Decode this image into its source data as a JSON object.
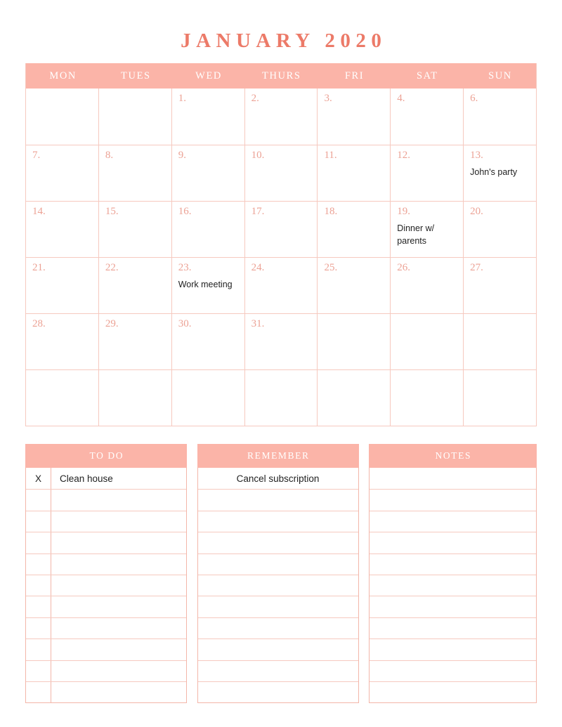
{
  "title": "JANUARY 2020",
  "calendar": {
    "weekdays": [
      "MON",
      "TUES",
      "WED",
      "THURS",
      "FRI",
      "SAT",
      "SUN"
    ],
    "weeks": [
      [
        {
          "day": "",
          "event": ""
        },
        {
          "day": "",
          "event": ""
        },
        {
          "day": "1.",
          "event": ""
        },
        {
          "day": "2.",
          "event": ""
        },
        {
          "day": "3.",
          "event": ""
        },
        {
          "day": "4.",
          "event": ""
        },
        {
          "day": "6.",
          "event": ""
        }
      ],
      [
        {
          "day": "7.",
          "event": ""
        },
        {
          "day": "8.",
          "event": ""
        },
        {
          "day": "9.",
          "event": ""
        },
        {
          "day": "10.",
          "event": ""
        },
        {
          "day": "11.",
          "event": ""
        },
        {
          "day": "12.",
          "event": ""
        },
        {
          "day": "13.",
          "event": "John's party"
        }
      ],
      [
        {
          "day": "14.",
          "event": ""
        },
        {
          "day": "15.",
          "event": ""
        },
        {
          "day": "16.",
          "event": ""
        },
        {
          "day": "17.",
          "event": ""
        },
        {
          "day": "18.",
          "event": ""
        },
        {
          "day": "19.",
          "event": "Dinner w/ parents"
        },
        {
          "day": "20.",
          "event": ""
        }
      ],
      [
        {
          "day": "21.",
          "event": ""
        },
        {
          "day": "22.",
          "event": ""
        },
        {
          "day": "23.",
          "event": "Work meeting"
        },
        {
          "day": "24.",
          "event": ""
        },
        {
          "day": "25.",
          "event": ""
        },
        {
          "day": "26.",
          "event": ""
        },
        {
          "day": "27.",
          "event": ""
        }
      ],
      [
        {
          "day": "28.",
          "event": ""
        },
        {
          "day": "29.",
          "event": ""
        },
        {
          "day": "30.",
          "event": ""
        },
        {
          "day": "31.",
          "event": ""
        },
        {
          "day": "",
          "event": ""
        },
        {
          "day": "",
          "event": ""
        },
        {
          "day": "",
          "event": ""
        }
      ],
      [
        {
          "day": "",
          "event": ""
        },
        {
          "day": "",
          "event": ""
        },
        {
          "day": "",
          "event": ""
        },
        {
          "day": "",
          "event": ""
        },
        {
          "day": "",
          "event": ""
        },
        {
          "day": "",
          "event": ""
        },
        {
          "day": "",
          "event": ""
        }
      ]
    ]
  },
  "todo": {
    "heading": "TO DO",
    "rows": [
      {
        "check": "X",
        "text": "Clean house"
      },
      {
        "check": "",
        "text": ""
      },
      {
        "check": "",
        "text": ""
      },
      {
        "check": "",
        "text": ""
      },
      {
        "check": "",
        "text": ""
      },
      {
        "check": "",
        "text": ""
      },
      {
        "check": "",
        "text": ""
      },
      {
        "check": "",
        "text": ""
      },
      {
        "check": "",
        "text": ""
      },
      {
        "check": "",
        "text": ""
      },
      {
        "check": "",
        "text": ""
      }
    ]
  },
  "remember": {
    "heading": "REMEMBER",
    "rows": [
      {
        "text": "Cancel subscription"
      },
      {
        "text": ""
      },
      {
        "text": ""
      },
      {
        "text": ""
      },
      {
        "text": ""
      },
      {
        "text": ""
      },
      {
        "text": ""
      },
      {
        "text": ""
      },
      {
        "text": ""
      },
      {
        "text": ""
      },
      {
        "text": ""
      }
    ]
  },
  "notes": {
    "heading": "NOTES",
    "rows": [
      {
        "text": ""
      },
      {
        "text": ""
      },
      {
        "text": ""
      },
      {
        "text": ""
      },
      {
        "text": ""
      },
      {
        "text": ""
      },
      {
        "text": ""
      },
      {
        "text": ""
      },
      {
        "text": ""
      },
      {
        "text": ""
      },
      {
        "text": ""
      }
    ]
  },
  "colors": {
    "accent_pink": "#fbb4a8",
    "grid_line": "#f6c9bf",
    "title_text": "#ec7a68",
    "daynum_text": "#eca295",
    "event_text": "#222222"
  }
}
